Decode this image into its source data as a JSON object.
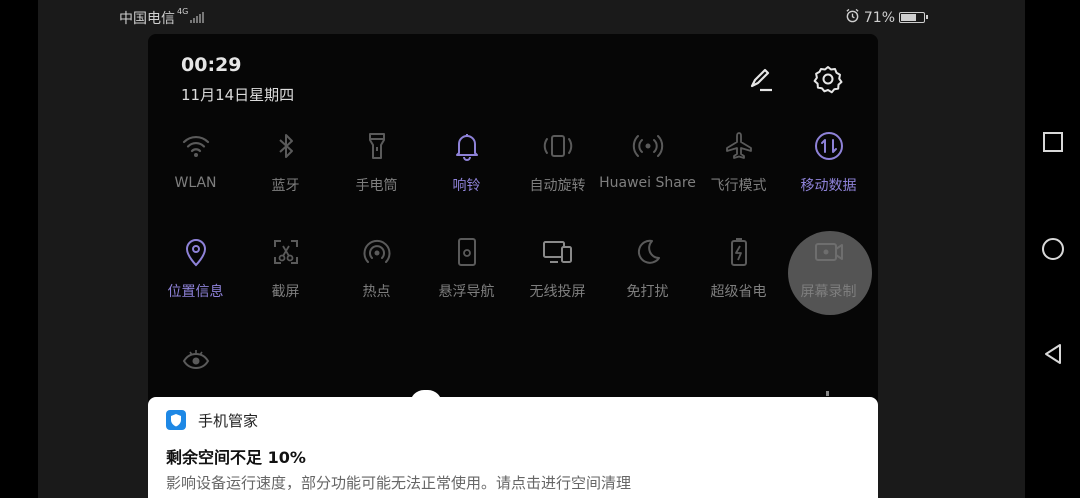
{
  "status_bar": {
    "carrier": "中国电信",
    "network_type": "4G",
    "battery_level": 71,
    "battery_text": "71%",
    "alarm_icon": "alarm-icon"
  },
  "panel": {
    "time": "00:29",
    "date": "11月14日星期四",
    "edit_icon": "edit-icon",
    "settings_icon": "gear-icon"
  },
  "tiles": [
    {
      "id": "wlan",
      "label": "WLAN",
      "icon": "wifi-icon",
      "active": false
    },
    {
      "id": "bluetooth",
      "label": "蓝牙",
      "icon": "bluetooth-icon",
      "active": false
    },
    {
      "id": "flashlight",
      "label": "手电筒",
      "icon": "flashlight-icon",
      "active": false
    },
    {
      "id": "ring",
      "label": "响铃",
      "icon": "bell-icon",
      "active": true
    },
    {
      "id": "auto-rotate",
      "label": "自动旋转",
      "icon": "rotate-icon",
      "active": false
    },
    {
      "id": "huawei-share",
      "label": "Huawei Share",
      "icon": "share-icon",
      "active": false
    },
    {
      "id": "airplane",
      "label": "飞行模式",
      "icon": "airplane-icon",
      "active": false
    },
    {
      "id": "mobile-data",
      "label": "移动数据",
      "icon": "mobile-data-icon",
      "active": true
    },
    {
      "id": "location",
      "label": "位置信息",
      "icon": "location-icon",
      "active": true
    },
    {
      "id": "screenshot",
      "label": "截屏",
      "icon": "scissors-icon",
      "active": false
    },
    {
      "id": "hotspot",
      "label": "热点",
      "icon": "hotspot-icon",
      "active": false
    },
    {
      "id": "floating-nav",
      "label": "悬浮导航",
      "icon": "floating-nav-icon",
      "active": false
    },
    {
      "id": "wireless-projection",
      "label": "无线投屏",
      "icon": "cast-icon",
      "active": false
    },
    {
      "id": "do-not-disturb",
      "label": "免打扰",
      "icon": "moon-icon",
      "active": false
    },
    {
      "id": "super-power-saving",
      "label": "超级省电",
      "icon": "battery-saver-icon",
      "active": false
    },
    {
      "id": "screen-recording",
      "label": "屏幕录制",
      "icon": "video-record-icon",
      "active": false
    },
    {
      "id": "eye-comfort",
      "label": "",
      "icon": "eye-icon",
      "active": false
    }
  ],
  "notification": {
    "app_name": "手机管家",
    "app_icon": "shield-icon",
    "title": "剩余空间不足 10%",
    "body": "影响设备运行速度，部分功能可能无法正常使用。请点击进行空间清理"
  },
  "nav_bar": {
    "recents_icon": "square-icon",
    "home_icon": "circle-icon",
    "back_icon": "triangle-back-icon"
  },
  "colors": {
    "active_tile": "#8e82d8",
    "inactive_tile": "#7e7e7e",
    "panel_background": "#060606",
    "notification_background": "#ffffff"
  }
}
